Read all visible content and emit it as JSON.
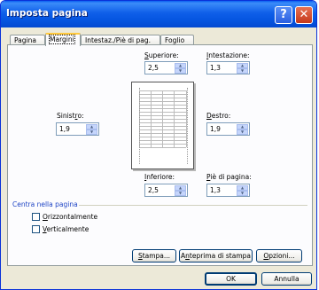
{
  "window": {
    "title": "Imposta pagina"
  },
  "tabs": [
    {
      "label": "Pagina"
    },
    {
      "label": "Margini"
    },
    {
      "label": "Intestaz./Piè di pag."
    },
    {
      "label": "Foglio"
    }
  ],
  "margins": {
    "top": {
      "label_pre": "",
      "label_key": "S",
      "label_post": "uperiore:",
      "value": "2,5"
    },
    "header": {
      "label_pre": "",
      "label_key": "I",
      "label_post": "ntestazione:",
      "value": "1,3"
    },
    "left": {
      "label_pre": "Sinist",
      "label_key": "r",
      "label_post": "o:",
      "value": "1,9"
    },
    "right": {
      "label_pre": "",
      "label_key": "D",
      "label_post": "estro:",
      "value": "1,9"
    },
    "bottom": {
      "label_pre": "",
      "label_key": "I",
      "label_post": "nferiore:",
      "value": "2,5"
    },
    "footer": {
      "label_pre": "",
      "label_key": "P",
      "label_post": "iè di pagina:",
      "value": "1,3"
    }
  },
  "center": {
    "title": "Centra nella pagina",
    "horizontal": {
      "label_pre": "",
      "label_key": "O",
      "label_post": "rizzontalmente",
      "checked": false
    },
    "vertical": {
      "label_pre": "",
      "label_key": "V",
      "label_post": "erticalmente",
      "checked": false
    }
  },
  "buttons": {
    "print": {
      "label_pre": "",
      "label_key": "S",
      "label_post": "tampa..."
    },
    "preview": {
      "label_pre": "A",
      "label_key": "n",
      "label_post": "teprima di stampa"
    },
    "options": {
      "label_pre": "",
      "label_key": "O",
      "label_post": "pzioni..."
    },
    "ok": {
      "label": "OK"
    },
    "cancel": {
      "label": "Annulla"
    }
  },
  "icons": {
    "help": "?",
    "close": "✕",
    "spin_up": "▲",
    "spin_down": "▼"
  }
}
